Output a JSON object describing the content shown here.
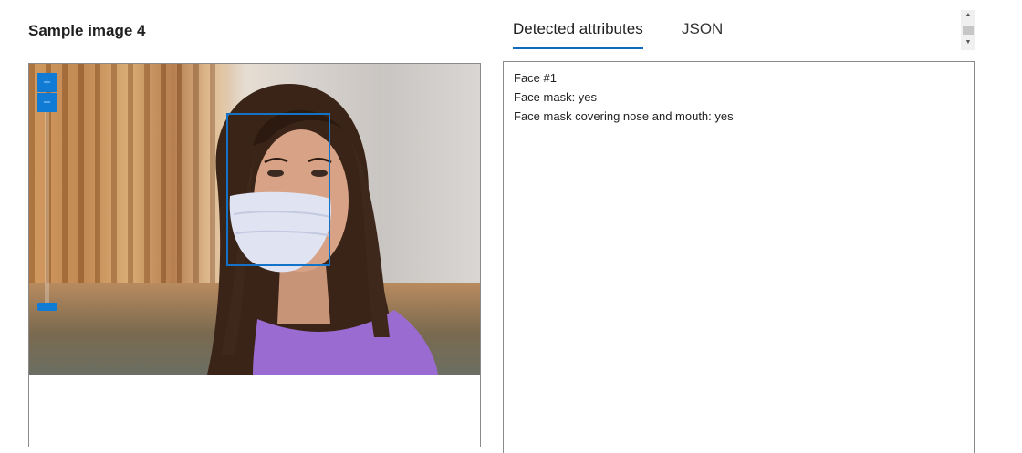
{
  "sample_title": "Sample image 4",
  "tabs": [
    {
      "label": "Detected attributes",
      "active": true
    },
    {
      "label": "JSON",
      "active": false
    }
  ],
  "zoom": {
    "zoom_in_label": "+",
    "zoom_out_label": "−",
    "level": 0.05
  },
  "results": {
    "lines": [
      "Face #1",
      "Face mask: yes",
      "Face mask covering nose and mouth: yes"
    ]
  },
  "colors": {
    "accent": "#0f7bd4",
    "face_box": "#1273c9"
  }
}
